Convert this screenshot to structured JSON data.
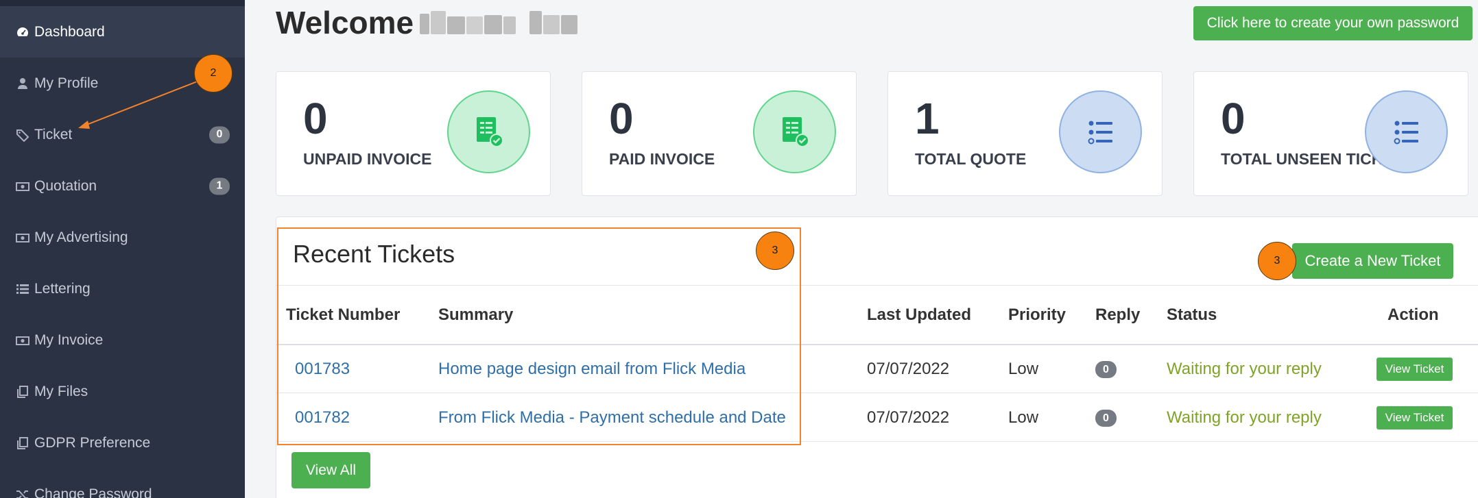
{
  "sidebar": {
    "items": [
      {
        "label": "Dashboard",
        "icon": "dashboard-icon",
        "active": true
      },
      {
        "label": "My Profile",
        "icon": "user-icon"
      },
      {
        "label": "Ticket",
        "icon": "tag-icon",
        "badge": "0"
      },
      {
        "label": "Quotation",
        "icon": "money-icon",
        "badge": "1"
      },
      {
        "label": "My Advertising",
        "icon": "money-icon"
      },
      {
        "label": "Lettering",
        "icon": "list-icon"
      },
      {
        "label": "My Invoice",
        "icon": "money-icon"
      },
      {
        "label": "My Files",
        "icon": "files-icon"
      },
      {
        "label": "GDPR Preference",
        "icon": "files-icon"
      },
      {
        "label": "Change Password",
        "icon": "random-icon"
      }
    ]
  },
  "header": {
    "welcome": "Welcome",
    "password_button": "Click here to create your own password"
  },
  "stats": [
    {
      "value": "0",
      "label": "UNPAID INVOICE",
      "icon": "invoice-check-icon",
      "color": "#62d58d"
    },
    {
      "value": "0",
      "label": "PAID INVOICE",
      "icon": "invoice-check-icon",
      "color": "#62d58d"
    },
    {
      "value": "1",
      "label": "TOTAL QUOTE",
      "icon": "list-bullets-icon",
      "color": "#8fb2e2"
    },
    {
      "value": "0",
      "label": "TOTAL UNSEEN TICKETS",
      "icon": "list-bullets-icon",
      "color": "#8fb2e2"
    }
  ],
  "tickets": {
    "title": "Recent Tickets",
    "new_button": "Create a New Ticket",
    "columns": [
      "Ticket Number",
      "Summary",
      "Last Updated",
      "Priority",
      "Reply",
      "Status",
      "Action"
    ],
    "rows": [
      {
        "number": "001783",
        "summary": "Home page design email from Flick Media",
        "updated": "07/07/2022",
        "priority": "Low",
        "reply": "0",
        "status": "Waiting for your reply",
        "action": "View Ticket"
      },
      {
        "number": "001782",
        "summary": "From Flick Media - Payment schedule and Date",
        "updated": "07/07/2022",
        "priority": "Low",
        "reply": "0",
        "status": "Waiting for your reply",
        "action": "View Ticket"
      }
    ],
    "view_all": "View All"
  },
  "annotations": {
    "markers": [
      "2",
      "3",
      "3"
    ],
    "color": "#f7820f"
  }
}
